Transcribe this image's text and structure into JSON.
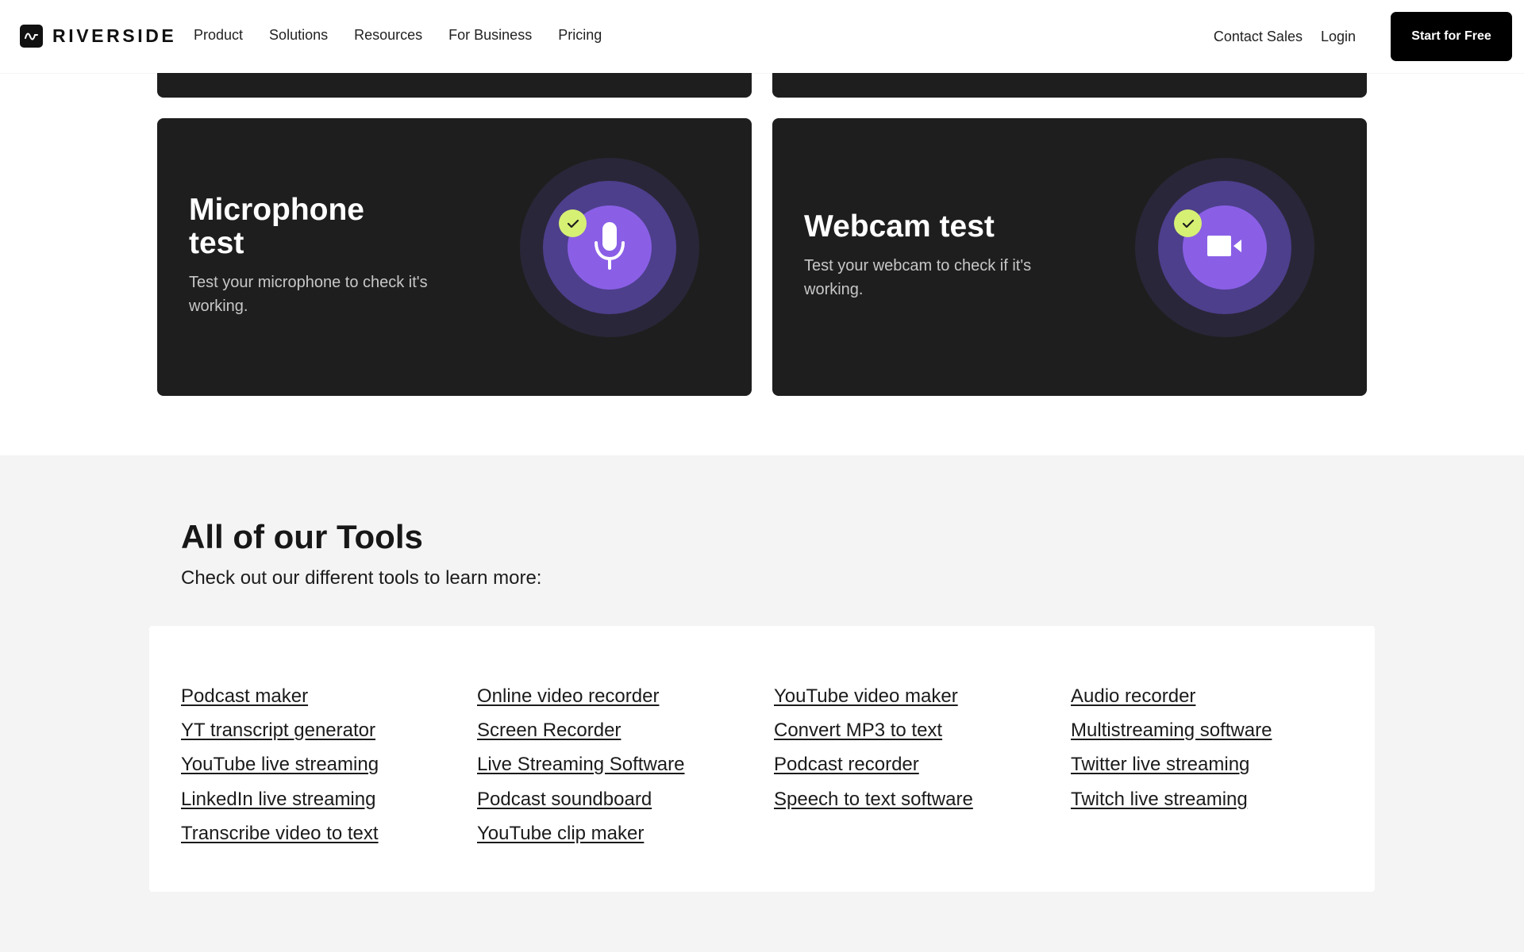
{
  "brand": {
    "name": "RIVERSIDE",
    "logo_icon": "riverside-wave-icon"
  },
  "nav": {
    "items": [
      {
        "label": "Product"
      },
      {
        "label": "Solutions"
      },
      {
        "label": "Resources"
      },
      {
        "label": "For Business"
      },
      {
        "label": "Pricing"
      }
    ],
    "contact_label": "Contact Sales",
    "login_label": "Login",
    "cta_label": "Start for Free"
  },
  "cards": {
    "microphone": {
      "title": "Microphone test",
      "description": "Test your microphone to check it's working.",
      "icon": "microphone-icon",
      "badge_icon": "check-icon"
    },
    "webcam": {
      "title": "Webcam test",
      "description": "Test your webcam to check if it's working.",
      "icon": "video-camera-icon",
      "badge_icon": "check-icon"
    }
  },
  "tools": {
    "title": "All of our Tools",
    "subtitle": "Check out our different tools to learn more:",
    "columns": [
      [
        "Podcast maker",
        "YT transcript generator",
        "YouTube live streaming",
        "LinkedIn live streaming",
        "Transcribe video to text"
      ],
      [
        "Online video recorder",
        "Screen Recorder",
        "Live Streaming Software",
        "Podcast soundboard",
        "YouTube clip maker"
      ],
      [
        "YouTube video maker",
        "Convert MP3 to text",
        "Podcast recorder",
        "Speech to text software"
      ],
      [
        "Audio recorder",
        "Multistreaming software",
        "Twitter live streaming",
        "Twitch live streaming"
      ]
    ]
  },
  "colors": {
    "card_bg": "#1e1e1e",
    "accent_purple": "#8a5fe6",
    "badge_green": "#d6f074",
    "section_bg": "#f4f4f4",
    "cta_bg": "#000000"
  }
}
